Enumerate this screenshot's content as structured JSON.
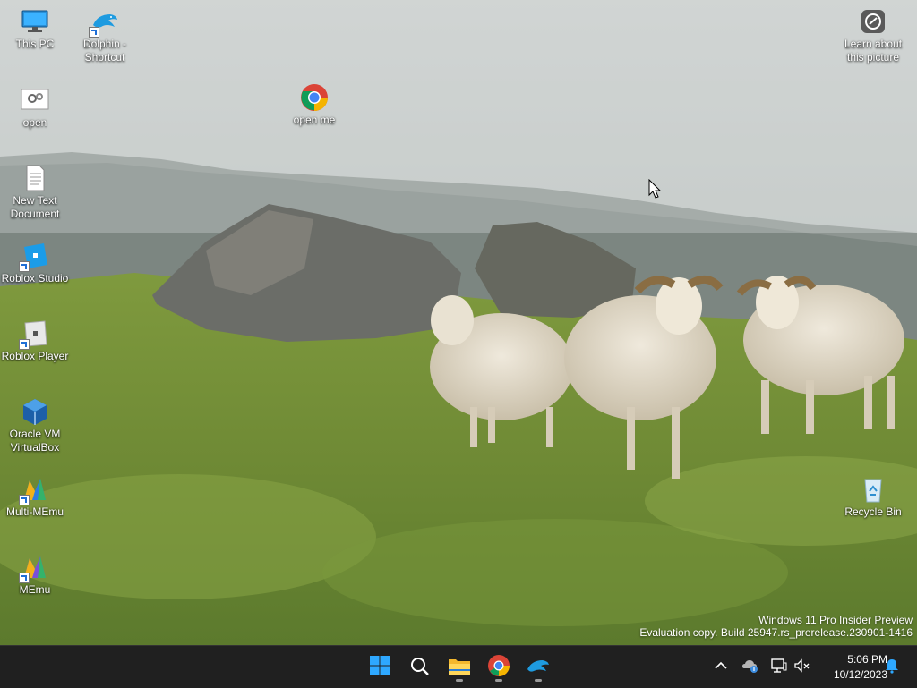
{
  "desktop_icons": [
    {
      "id": "this-pc",
      "label": "This PC"
    },
    {
      "id": "dolphin-shortcut",
      "label": "Dolphin - Shortcut"
    },
    {
      "id": "learn-picture",
      "label": "Learn about this picture"
    },
    {
      "id": "open",
      "label": "open"
    },
    {
      "id": "open-me",
      "label": "open me"
    },
    {
      "id": "new-text-document",
      "label": "New Text Document"
    },
    {
      "id": "roblox-studio",
      "label": "Roblox Studio"
    },
    {
      "id": "roblox-player",
      "label": "Roblox Player"
    },
    {
      "id": "oracle-virtualbox",
      "label": "Oracle VM VirtualBox"
    },
    {
      "id": "multi-memu",
      "label": "Multi-MEmu"
    },
    {
      "id": "memu",
      "label": "MEmu"
    },
    {
      "id": "recycle-bin",
      "label": "Recycle Bin"
    }
  ],
  "watermark": {
    "line1": "Windows 11 Pro Insider Preview",
    "line2": "Evaluation copy. Build 25947.rs_prerelease.230901-1416"
  },
  "taskbar": {
    "apps": [
      "start",
      "search",
      "file-explorer",
      "chrome",
      "dolphin"
    ],
    "clock": {
      "time": "5:06 PM",
      "date": "10/12/2023"
    }
  },
  "colors": {
    "taskbar": "#202020",
    "accent": "#1f9bf0"
  }
}
